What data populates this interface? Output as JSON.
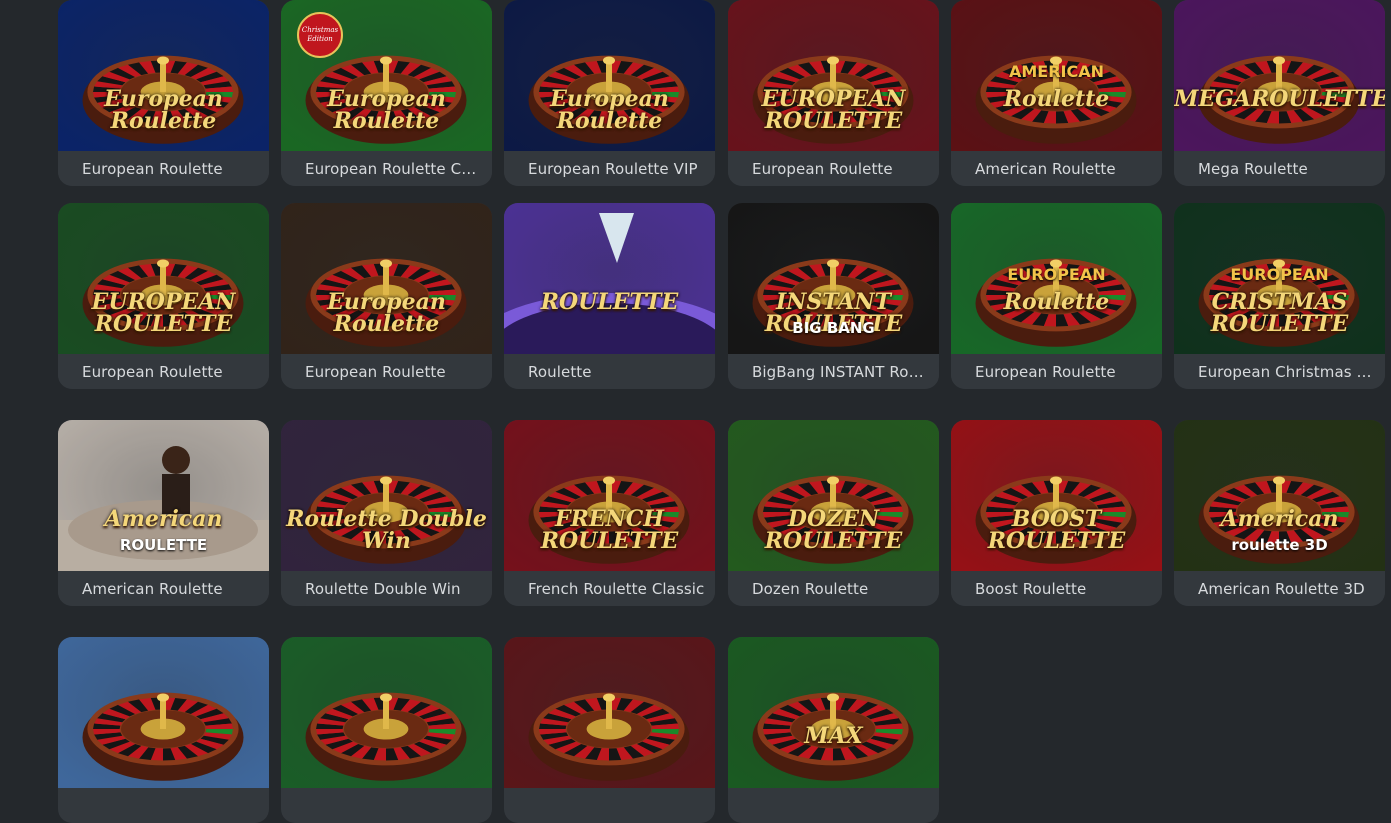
{
  "games": [
    {
      "title": "European Roulette",
      "art_text": "European Roulette",
      "theme": "#0d2a7a"
    },
    {
      "title": "European Roulette Christmas Edition",
      "art_text": "European Roulette",
      "badge": "Christmas Edition",
      "theme": "#1f7a2a"
    },
    {
      "title": "European Roulette VIP",
      "art_text": "European Roulette",
      "theme": "#0f1e52"
    },
    {
      "title": "European Roulette",
      "art_text": "EUROPEAN ROULETTE",
      "theme": "#7a1620"
    },
    {
      "title": "American Roulette",
      "art_text": "Roulette",
      "art_super": "AMERICAN",
      "theme": "#6b1418"
    },
    {
      "title": "Mega Roulette",
      "art_text": "MEGAROULETTE",
      "theme": "#5a1a6e"
    },
    {
      "title": "European Roulette",
      "art_text": "EUROPEAN ROULETTE",
      "theme": "#1e5a28"
    },
    {
      "title": "European Roulette",
      "art_text": "European Roulette",
      "theme": "#3a2a1e"
    },
    {
      "title": "Roulette",
      "art_text": "ROULETTE",
      "theme": "#5a3ab0"
    },
    {
      "title": "BigBang INSTANT Roulette",
      "art_text": "INSTANT ROULETTE",
      "art_sub": "BIG BANG",
      "theme": "#1a1a1a"
    },
    {
      "title": "European Roulette",
      "art_text": "Roulette",
      "art_super": "EUROPEAN",
      "theme": "#1c7a2e"
    },
    {
      "title": "European Christmas Roulette",
      "art_text": "CRISTMAS ROULETTE",
      "art_super": "EUROPEAN",
      "theme": "#123a22"
    },
    {
      "title": "American Roulette",
      "art_text": "American",
      "art_sub": "ROULETTE",
      "theme": "#d8cfc6"
    },
    {
      "title": "Roulette Double Win",
      "art_text": "Roulette Double Win",
      "theme": "#3a2a48"
    },
    {
      "title": "French Roulette Classic",
      "art_text": "FRENCH ROULETTE",
      "theme": "#8a1420"
    },
    {
      "title": "Dozen Roulette",
      "art_text": "DOZEN ROULETTE",
      "theme": "#2a6a24"
    },
    {
      "title": "Boost Roulette",
      "art_text": "BOOST ROULETTE",
      "theme": "#b0141a"
    },
    {
      "title": "American Roulette 3D",
      "art_text": "American",
      "art_sub": "roulette 3D",
      "theme": "#2a3a18"
    },
    {
      "title": "",
      "theme": "#4a7ab8"
    },
    {
      "title": "",
      "theme": "#1f6e2e"
    },
    {
      "title": "",
      "theme": "#6a1a1e"
    },
    {
      "title": "",
      "theme": "#1f6a28",
      "art_text": "MAX"
    }
  ]
}
